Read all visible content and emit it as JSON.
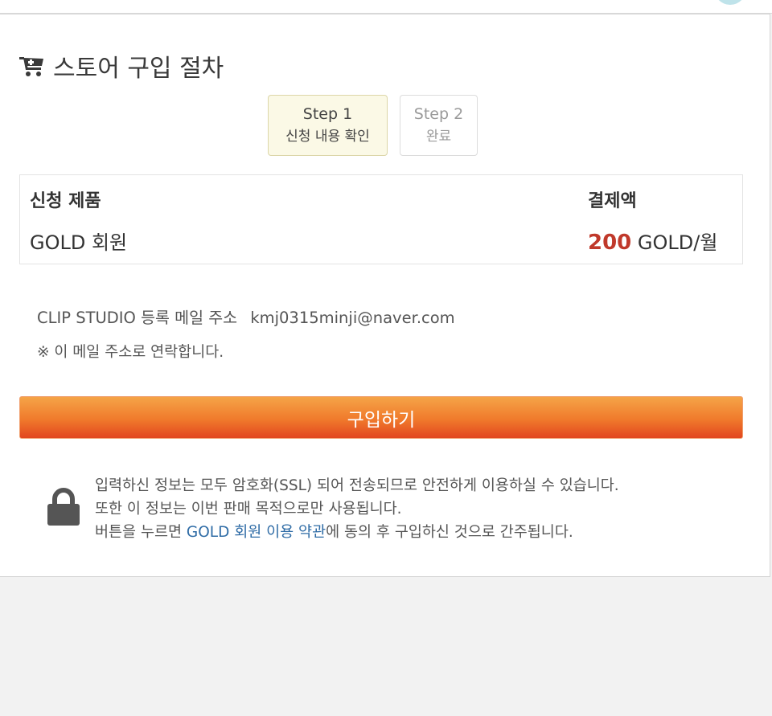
{
  "page": {
    "title": "스토어 구입 절차",
    "title_icon": "cart-add-icon"
  },
  "steps": [
    {
      "label": "Step 1",
      "sub": "신청 내용 확인",
      "active": true
    },
    {
      "label": "Step 2",
      "sub": "완료",
      "active": false
    }
  ],
  "order": {
    "product_header": "신청 제품",
    "amount_header": "결제액",
    "product_name": "GOLD 회원",
    "amount_value": "200",
    "amount_unit": "GOLD/월",
    "amount_color": "#c0392b"
  },
  "email": {
    "label": "CLIP STUDIO 등록 메일 주소",
    "value": "kmj0315minji@naver.com",
    "notice": "※ 이 메일 주소로 연락합니다."
  },
  "purchase_button": {
    "label": "구입하기"
  },
  "security": {
    "icon": "lock-icon",
    "line1": "입력하신 정보는 모두 암호화(SSL) 되어 전송되므로 안전하게 이용하실 수 있습니다.",
    "line2": "또한 이 정보는 이번 판매 목적으로만 사용됩니다.",
    "line3_prefix": "버튼을 누르면 ",
    "line3_link": "GOLD 회원 이용 약관",
    "line3_suffix": "에 동의 후 구입하신 것으로 간주됩니다.",
    "link_color": "#2f6ca6"
  }
}
